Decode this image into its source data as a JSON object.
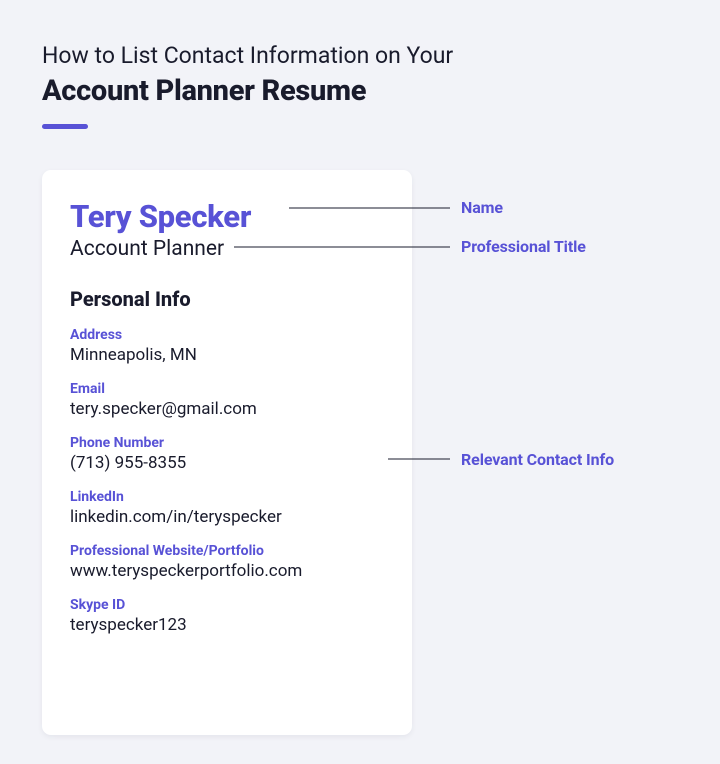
{
  "heading": {
    "line1": "How to List Contact Information on Your",
    "line2": "Account Planner Resume"
  },
  "card": {
    "name": "Tery Specker",
    "title": "Account Planner",
    "section_heading": "Personal Info",
    "fields": {
      "address": {
        "label": "Address",
        "value": "Minneapolis, MN"
      },
      "email": {
        "label": "Email",
        "value": "tery.specker@gmail.com"
      },
      "phone": {
        "label": "Phone Number",
        "value": "(713) 955-8355"
      },
      "linkedin": {
        "label": "LinkedIn",
        "value": "linkedin.com/in/teryspecker"
      },
      "website": {
        "label": "Professional Website/Portfolio",
        "value": "www.teryspeckerportfolio.com"
      },
      "skype": {
        "label": "Skype ID",
        "value": "teryspecker123"
      }
    }
  },
  "annotations": {
    "name": "Name",
    "title": "Professional Title",
    "contact": "Relevant Contact Info"
  }
}
